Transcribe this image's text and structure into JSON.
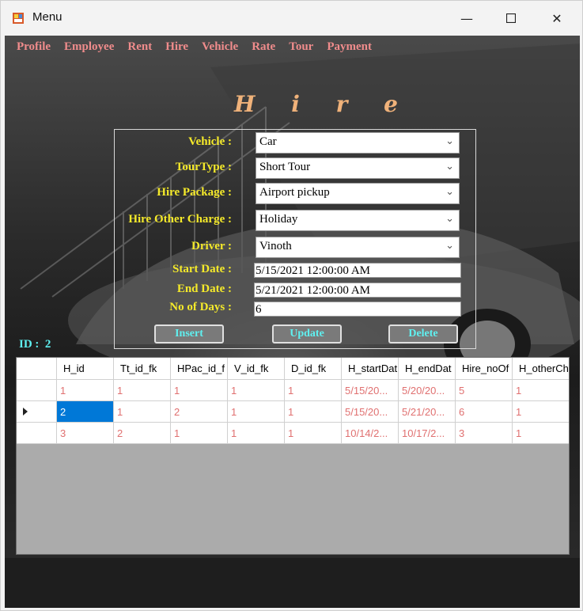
{
  "window": {
    "title": "Menu"
  },
  "menu": [
    "Profile",
    "Employee",
    "Rent",
    "Hire",
    "Vehicle",
    "Rate",
    "Tour",
    "Payment"
  ],
  "form": {
    "heading": "H i r e",
    "vehicle_label": "Vehicle :",
    "vehicle_value": "Car",
    "tourtype_label": "TourType :",
    "tourtype_value": "Short Tour",
    "package_label": "Hire Package :",
    "package_value": "Airport pickup",
    "othercharge_label": "Hire Other Charge :",
    "othercharge_value": "Holiday",
    "driver_label": "Driver :",
    "driver_value": "Vinoth",
    "startdate_label": "Start Date :",
    "startdate_value": "5/15/2021 12:00:00 AM",
    "enddate_label": "End Date :",
    "enddate_value": "5/21/2021 12:00:00 AM",
    "days_label": "No of Days :",
    "days_value": "6"
  },
  "buttons": {
    "insert": "Insert",
    "update": "Update",
    "delete": "Delete"
  },
  "id_display": {
    "label": "ID :",
    "value": "2"
  },
  "grid": {
    "columns": [
      "H_id",
      "Tt_id_fk",
      "HPac_id_f",
      "V_id_fk",
      "D_id_fk",
      "H_startDat",
      "H_endDat",
      "Hire_noOf",
      "H_otherCh"
    ],
    "rows": [
      [
        "1",
        "1",
        "1",
        "1",
        "1",
        "5/15/20...",
        "5/20/20...",
        "5",
        "1"
      ],
      [
        "2",
        "1",
        "2",
        "1",
        "1",
        "5/15/20...",
        "5/21/20...",
        "6",
        "1"
      ],
      [
        "3",
        "2",
        "1",
        "1",
        "1",
        "10/14/2...",
        "10/17/2...",
        "3",
        "1"
      ]
    ],
    "selected_row": 1
  },
  "colors": {
    "menu_text": "#f08c8c",
    "label_text": "#f5ea2a",
    "button_text": "#5ff0f0",
    "heading": "#f0b27a",
    "selection": "#0078d7"
  }
}
